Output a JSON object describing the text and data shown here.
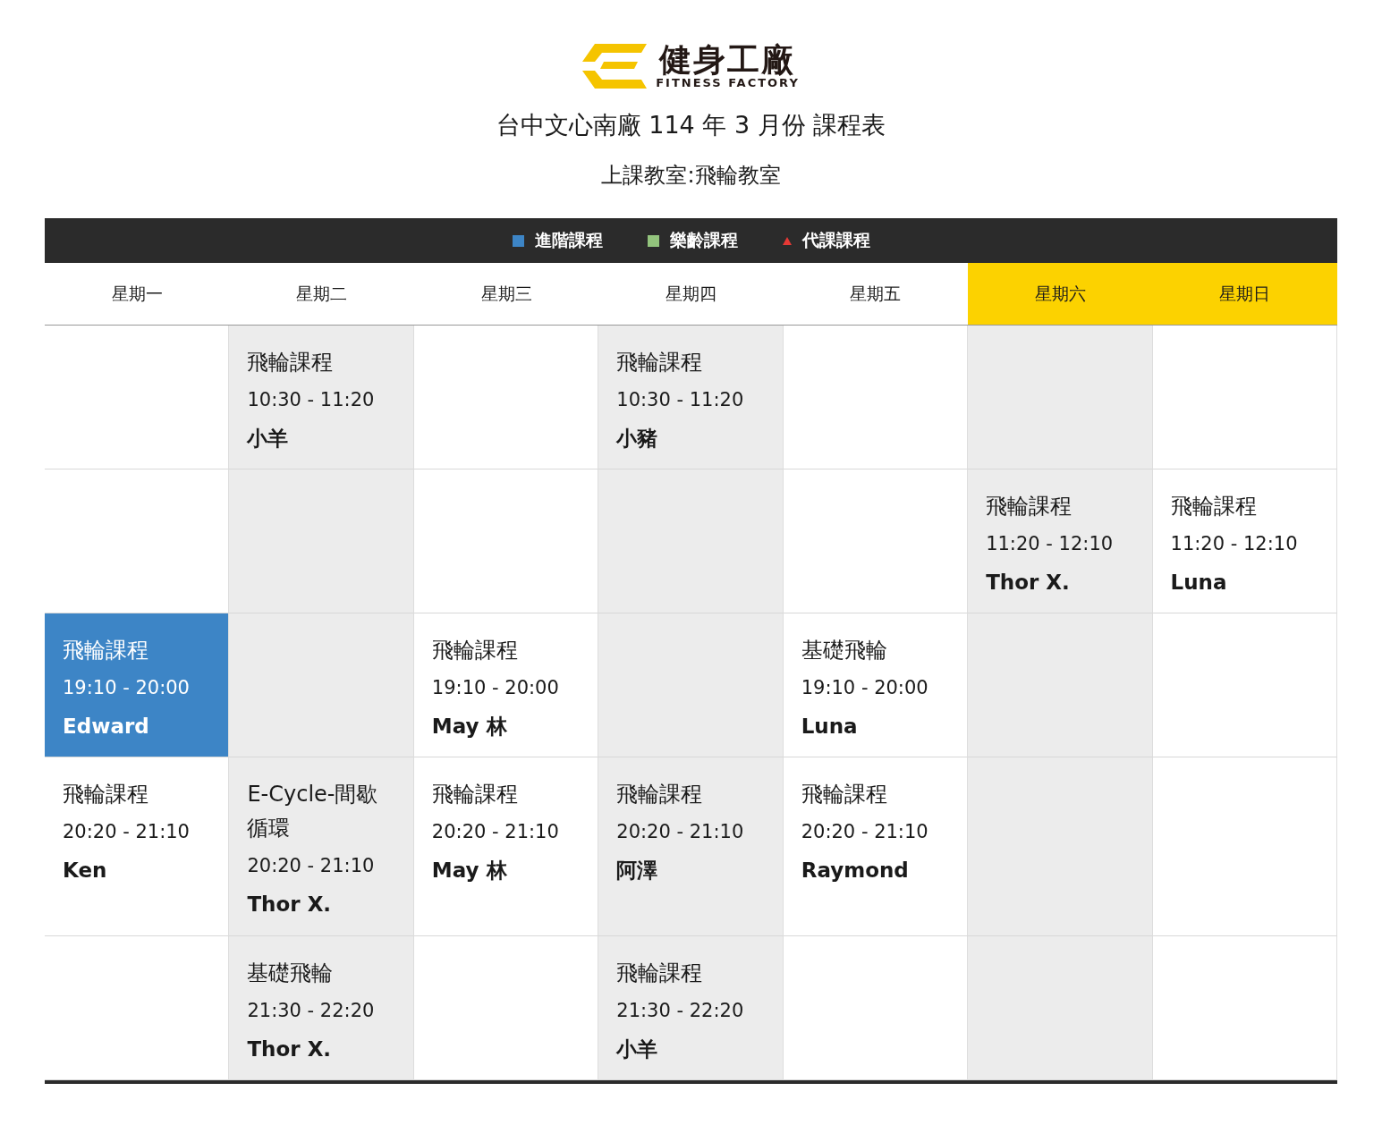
{
  "logo": {
    "name": "健身工廠",
    "subtitle": "FITNESS FACTORY"
  },
  "title": "台中文心南廠 114 年 3 月份 課程表",
  "classroom": "上課教室:飛輪教室",
  "legend": [
    {
      "label": "進階課程",
      "kind": "square",
      "color": "#3d85c6"
    },
    {
      "label": "樂齡課程",
      "kind": "square",
      "color": "#93c47d"
    },
    {
      "label": "代課課程",
      "kind": "triangle",
      "color": "#e53935"
    }
  ],
  "days": [
    {
      "label": "星期一",
      "highlighted": false
    },
    {
      "label": "星期二",
      "highlighted": false
    },
    {
      "label": "星期三",
      "highlighted": false
    },
    {
      "label": "星期四",
      "highlighted": false
    },
    {
      "label": "星期五",
      "highlighted": false
    },
    {
      "label": "星期六",
      "highlighted": true
    },
    {
      "label": "星期日",
      "highlighted": true
    }
  ],
  "rows": [
    {
      "cells": [
        {},
        {
          "title": "飛輪課程",
          "time": "10:30 - 11:20",
          "instructor": "小羊",
          "kind": "regular"
        },
        {},
        {
          "title": "飛輪課程",
          "time": "10:30 - 11:20",
          "instructor": "小豬",
          "kind": "regular"
        },
        {},
        {},
        {}
      ]
    },
    {
      "cells": [
        {},
        {},
        {},
        {},
        {},
        {
          "title": "飛輪課程",
          "time": "11:20 - 12:10",
          "instructor": "Thor X.",
          "kind": "regular"
        },
        {
          "title": "飛輪課程",
          "time": "11:20 - 12:10",
          "instructor": "Luna",
          "kind": "regular"
        }
      ]
    },
    {
      "cells": [
        {
          "title": "飛輪課程",
          "time": "19:10 - 20:00",
          "instructor": "Edward",
          "kind": "advanced"
        },
        {},
        {
          "title": "飛輪課程",
          "time": "19:10 - 20:00",
          "instructor": "May 林",
          "kind": "regular"
        },
        {},
        {
          "title": "基礎飛輪",
          "time": "19:10 - 20:00",
          "instructor": "Luna",
          "kind": "regular"
        },
        {},
        {}
      ]
    },
    {
      "cells": [
        {
          "title": "飛輪課程",
          "time": "20:20 - 21:10",
          "instructor": "Ken",
          "kind": "regular"
        },
        {
          "title": "E-Cycle-間歇循環",
          "time": "20:20 - 21:10",
          "instructor": "Thor X.",
          "kind": "regular"
        },
        {
          "title": "飛輪課程",
          "time": "20:20 - 21:10",
          "instructor": "May 林",
          "kind": "regular"
        },
        {
          "title": "飛輪課程",
          "time": "20:20 - 21:10",
          "instructor": "阿澤",
          "kind": "regular"
        },
        {
          "title": "飛輪課程",
          "time": "20:20 - 21:10",
          "instructor": "Raymond",
          "kind": "regular"
        },
        {},
        {}
      ]
    },
    {
      "cells": [
        {},
        {
          "title": "基礎飛輪",
          "time": "21:30 - 22:20",
          "instructor": "Thor X.",
          "kind": "regular"
        },
        {},
        {
          "title": "飛輪課程",
          "time": "21:30 - 22:20",
          "instructor": "小羊",
          "kind": "regular"
        },
        {},
        {},
        {}
      ]
    }
  ]
}
